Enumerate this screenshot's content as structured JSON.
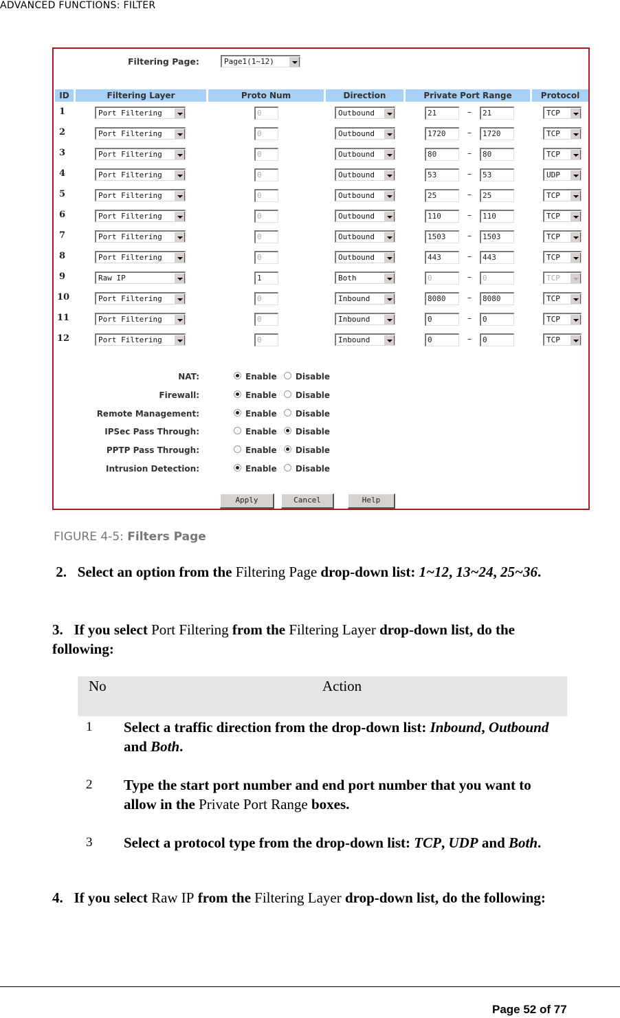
{
  "running_head": "ADVANCED FUNCTIONS: FILTER",
  "figure": {
    "filtering_page_label": "Filtering Page:",
    "filtering_page_value": "Page1(1~12)",
    "headers": {
      "id": "ID",
      "filtering_layer": "Filtering Layer",
      "proto_num": "Proto Num",
      "direction": "Direction",
      "private_port_range": "Private Port Range",
      "protocol": "Protocol"
    },
    "range_separator": "–",
    "rows": [
      {
        "id": "1",
        "layer": "Port Filtering",
        "proto": "0",
        "proto_disabled": true,
        "direction": "Outbound",
        "start": "21",
        "end": "21",
        "ports_disabled": false,
        "protocol": "TCP",
        "protocol_disabled": false
      },
      {
        "id": "2",
        "layer": "Port Filtering",
        "proto": "0",
        "proto_disabled": true,
        "direction": "Outbound",
        "start": "1720",
        "end": "1720",
        "ports_disabled": false,
        "protocol": "TCP",
        "protocol_disabled": false
      },
      {
        "id": "3",
        "layer": "Port Filtering",
        "proto": "0",
        "proto_disabled": true,
        "direction": "Outbound",
        "start": "80",
        "end": "80",
        "ports_disabled": false,
        "protocol": "TCP",
        "protocol_disabled": false
      },
      {
        "id": "4",
        "layer": "Port Filtering",
        "proto": "0",
        "proto_disabled": true,
        "direction": "Outbound",
        "start": "53",
        "end": "53",
        "ports_disabled": false,
        "protocol": "UDP",
        "protocol_disabled": false
      },
      {
        "id": "5",
        "layer": "Port Filtering",
        "proto": "0",
        "proto_disabled": true,
        "direction": "Outbound",
        "start": "25",
        "end": "25",
        "ports_disabled": false,
        "protocol": "TCP",
        "protocol_disabled": false
      },
      {
        "id": "6",
        "layer": "Port Filtering",
        "proto": "0",
        "proto_disabled": true,
        "direction": "Outbound",
        "start": "110",
        "end": "110",
        "ports_disabled": false,
        "protocol": "TCP",
        "protocol_disabled": false
      },
      {
        "id": "7",
        "layer": "Port Filtering",
        "proto": "0",
        "proto_disabled": true,
        "direction": "Outbound",
        "start": "1503",
        "end": "1503",
        "ports_disabled": false,
        "protocol": "TCP",
        "protocol_disabled": false
      },
      {
        "id": "8",
        "layer": "Port Filtering",
        "proto": "0",
        "proto_disabled": true,
        "direction": "Outbound",
        "start": "443",
        "end": "443",
        "ports_disabled": false,
        "protocol": "TCP",
        "protocol_disabled": false
      },
      {
        "id": "9",
        "layer": "Raw IP",
        "proto": "1",
        "proto_disabled": false,
        "direction": "Both",
        "start": "0",
        "end": "0",
        "ports_disabled": true,
        "protocol": "TCP",
        "protocol_disabled": true
      },
      {
        "id": "10",
        "layer": "Port Filtering",
        "proto": "0",
        "proto_disabled": true,
        "direction": "Inbound",
        "start": "8080",
        "end": "8080",
        "ports_disabled": false,
        "protocol": "TCP",
        "protocol_disabled": false
      },
      {
        "id": "11",
        "layer": "Port Filtering",
        "proto": "0",
        "proto_disabled": true,
        "direction": "Inbound",
        "start": "0",
        "end": "0",
        "ports_disabled": false,
        "protocol": "TCP",
        "protocol_disabled": false
      },
      {
        "id": "12",
        "layer": "Port Filtering",
        "proto": "0",
        "proto_disabled": true,
        "direction": "Inbound",
        "start": "0",
        "end": "0",
        "ports_disabled": false,
        "protocol": "TCP",
        "protocol_disabled": false
      }
    ],
    "enable_label": "Enable",
    "disable_label": "Disable",
    "options": [
      {
        "label": "NAT:",
        "enabled": true
      },
      {
        "label": "Firewall:",
        "enabled": true
      },
      {
        "label": "Remote Management:",
        "enabled": true
      },
      {
        "label": "IPSec Pass Through:",
        "enabled": false
      },
      {
        "label": "PPTP Pass Through:",
        "enabled": false
      },
      {
        "label": "Intrusion Detection:",
        "enabled": true
      }
    ],
    "buttons": {
      "apply": "Apply",
      "cancel": "Cancel",
      "help": "Help"
    }
  },
  "caption": {
    "prefix": "FIGURE 4-5: ",
    "title": "Filters Page"
  },
  "steps": {
    "s2": {
      "num": "2.",
      "t1": "Select an option from the ",
      "t2": "Filtering Page",
      "t3": " drop-down list: ",
      "o1": "1~12",
      "c1": ", ",
      "o2": "13~24",
      "c2": ", ",
      "o3": "25~36",
      "end": "."
    },
    "s3": {
      "num": "3.",
      "t1": "If you select ",
      "t2": "Port Filtering",
      "t3": " from the ",
      "t4": "Filtering Layer",
      "t5": " drop-down list, do the following:"
    },
    "s4": {
      "num": "4.",
      "t1": "If you select ",
      "t2": "Raw IP",
      "t3": " from the ",
      "t4": "Filtering Layer",
      "t5": " drop-down list, do the following:"
    }
  },
  "action_table": {
    "headers": {
      "no": "No",
      "action": "Action"
    },
    "rows": [
      {
        "no": "1",
        "a1": "Select a traffic direction from the drop-down list: ",
        "i1": "Inbound",
        "a2": ", ",
        "i2": "Outbound",
        "a3": " and ",
        "i3": "Both",
        "a4": "."
      },
      {
        "no": "2",
        "a1": "Type the start port number and end port number that you want to allow in the ",
        "n1": "Private Port Range",
        "a2": " boxes."
      },
      {
        "no": "3",
        "a1": "Select a protocol type from the drop-down list: ",
        "i1": "TCP",
        "a2": ", ",
        "i2": "UDP",
        "a3": " and ",
        "i3": "Both",
        "a4": "."
      }
    ]
  },
  "footer": {
    "page": "Page 52 of 77"
  }
}
